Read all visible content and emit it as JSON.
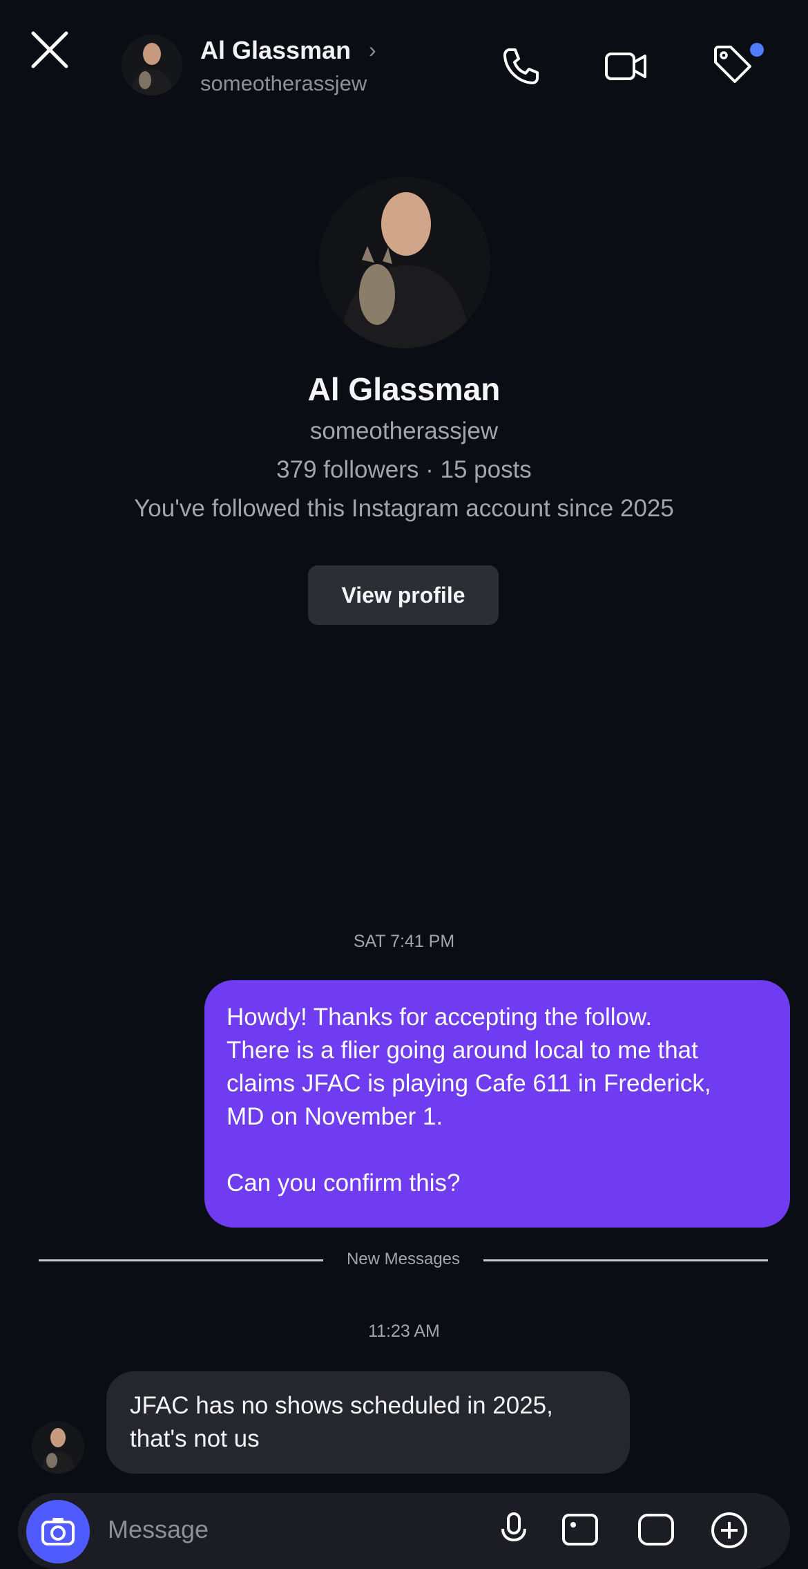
{
  "header": {
    "contact_name": "Al Glassman",
    "chevron": "›",
    "contact_username": "someotherassjew",
    "icons": {
      "close": "close-icon",
      "phone": "phone-icon",
      "video": "video-camera-icon",
      "tag": "tag-icon"
    },
    "notification_dot_color": "#4f7cff"
  },
  "profile": {
    "name": "Al Glassman",
    "username": "someotherassjew",
    "stats": "379 followers · 15 posts",
    "follow_info": "You've followed this Instagram account since 2025",
    "view_profile_label": "View profile"
  },
  "chat": {
    "timestamp_1": "SAT 7:41 PM",
    "outgoing_message": "Howdy! Thanks for accepting the follow.\nThere is a flier going around local to me that\nclaims JFAC is playing Cafe 611 in Frederick,\nMD on November 1.\n\nCan you confirm this?",
    "new_messages_label": "New Messages",
    "timestamp_2": "11:23 AM",
    "incoming_message": "JFAC has no shows scheduled in 2025,\nthat's not us"
  },
  "composer": {
    "placeholder": "Message",
    "icons": [
      "camera-icon",
      "microphone-icon",
      "gallery-icon",
      "sticker-icon",
      "plus-icon"
    ]
  },
  "colors": {
    "background": "#0b0d14",
    "outgoing_bubble": "#6f3cf2",
    "incoming_bubble": "#26272e",
    "secondary_text": "#a3a5ae"
  }
}
